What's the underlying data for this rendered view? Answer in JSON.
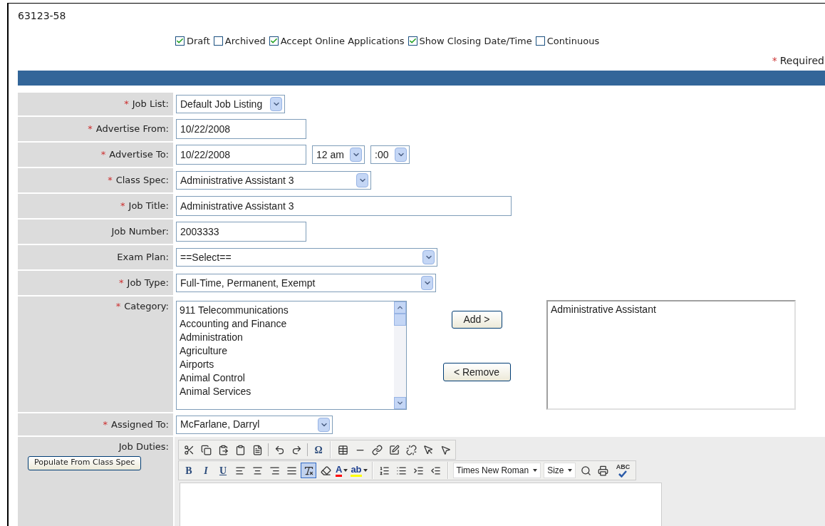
{
  "record_id": "63123-58",
  "flags": [
    {
      "label": "Draft",
      "checked": true
    },
    {
      "label": "Archived",
      "checked": false
    },
    {
      "label": "Accept Online Applications",
      "checked": true
    },
    {
      "label": "Show Closing Date/Time",
      "checked": true
    },
    {
      "label": "Continuous",
      "checked": false
    }
  ],
  "required_note": {
    "mark": "*",
    "text": "Required"
  },
  "form": [
    {
      "kind": "select",
      "label": "Job List:",
      "required": true,
      "value": "Default Job Listing"
    },
    {
      "kind": "text",
      "label": "Advertise From:",
      "required": true,
      "value": "10/22/2008"
    },
    {
      "kind": "datetime",
      "label": "Advertise To:",
      "required": true,
      "value": "10/22/2008",
      "hour": "12 am",
      "minute": ":00"
    },
    {
      "kind": "select",
      "label": "Class Spec:",
      "required": true,
      "value": "Administrative Assistant 3"
    },
    {
      "kind": "text",
      "label": "Job Title:",
      "required": true,
      "value": "Administrative Assistant 3"
    },
    {
      "kind": "text",
      "label": "Job Number:",
      "required": false,
      "value": "2003333"
    },
    {
      "kind": "select",
      "label": "Exam Plan:",
      "required": false,
      "value": "==Select=="
    },
    {
      "kind": "select",
      "label": "Job Type:",
      "required": true,
      "value": "Full-Time, Permanent, Exempt"
    },
    {
      "kind": "listbox",
      "label": "Category:",
      "required": true,
      "options": [
        "911 Telecommunications",
        "Accounting and Finance",
        "Administration",
        "Agriculture",
        "Airports",
        "Animal Control",
        "Animal Services"
      ],
      "add_button": "Add >",
      "remove_button": "< Remove",
      "chosen": [
        "Administrative Assistant"
      ]
    },
    {
      "kind": "select",
      "label": "Assigned To:",
      "required": true,
      "value": "McFarlane, Darryl"
    },
    {
      "kind": "editor",
      "label": "Job Duties:",
      "required": false,
      "button": "Populate From Class Spec",
      "toolbar": [
        [
          {
            "kind": "icon",
            "pressed": false
          },
          {
            "kind": "icon",
            "pressed": false
          },
          {
            "kind": "icon",
            "pressed": false
          },
          {
            "kind": "icon",
            "pressed": false
          },
          {
            "kind": "icon",
            "pressed": false
          },
          {
            "kind": "sep"
          },
          {
            "kind": "icon",
            "pressed": false
          },
          {
            "kind": "icon",
            "pressed": false
          },
          {
            "kind": "sep"
          },
          {
            "kind": "glyph",
            "label": "Ω",
            "pressed": false
          },
          {
            "kind": "gap"
          },
          {
            "kind": "icon",
            "pressed": false
          },
          {
            "kind": "icon",
            "pressed": false
          },
          {
            "kind": "icon",
            "pressed": false
          },
          {
            "kind": "icon",
            "pressed": false
          },
          {
            "kind": "icon",
            "pressed": false
          },
          {
            "kind": "icon",
            "pressed": false
          },
          {
            "kind": "icon",
            "pressed": false
          }
        ],
        [
          {
            "kind": "glyph",
            "label": "B",
            "pressed": false
          },
          {
            "kind": "glyph",
            "label": "I",
            "pressed": false
          },
          {
            "kind": "glyph",
            "label": "U",
            "pressed": false
          },
          {
            "kind": "icon",
            "pressed": false
          },
          {
            "kind": "icon",
            "pressed": false
          },
          {
            "kind": "icon",
            "pressed": false
          },
          {
            "kind": "icon",
            "pressed": false
          },
          {
            "kind": "icon",
            "pressed": true
          },
          {
            "kind": "icon",
            "pressed": false
          },
          {
            "kind": "color",
            "label": "A",
            "color": "#ff0000"
          },
          {
            "kind": "color",
            "label": "ab",
            "color": "#ffff00"
          },
          {
            "kind": "gap"
          },
          {
            "kind": "icon",
            "pressed": false
          },
          {
            "kind": "icon",
            "pressed": false
          },
          {
            "kind": "icon",
            "pressed": false
          },
          {
            "kind": "icon",
            "pressed": false
          },
          {
            "kind": "gap"
          },
          {
            "kind": "dropdown",
            "label": "Times New Roman"
          },
          {
            "kind": "dropdown",
            "label": "Size"
          },
          {
            "kind": "icon",
            "pressed": false
          },
          {
            "kind": "icon",
            "pressed": false
          },
          {
            "kind": "spell",
            "label": "ABC"
          }
        ]
      ]
    }
  ]
}
